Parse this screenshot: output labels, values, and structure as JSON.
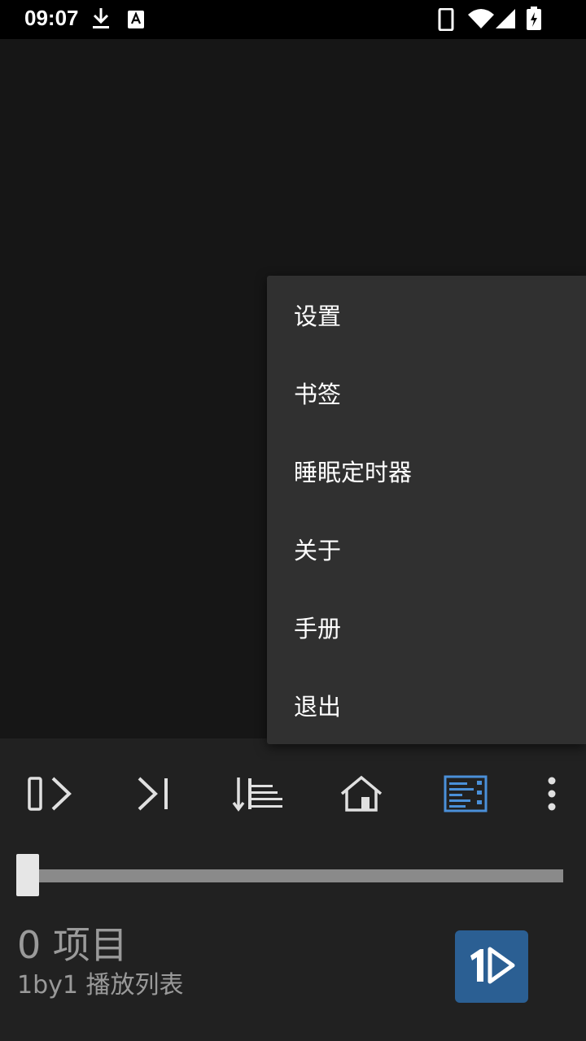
{
  "status_bar": {
    "time": "09:07",
    "icons": [
      "download-icon",
      "keyboard-a-icon",
      "phone-icon",
      "wifi-icon",
      "signal-icon",
      "battery-charging-icon"
    ]
  },
  "menu": {
    "items": [
      {
        "label": "设置"
      },
      {
        "label": "书签"
      },
      {
        "label": "睡眠定时器"
      },
      {
        "label": "关于"
      },
      {
        "label": "手册"
      },
      {
        "label": "退出"
      }
    ]
  },
  "toolbar": {
    "icons": [
      "play-next-icon",
      "skip-end-icon",
      "sort-icon",
      "home-icon",
      "playlist-view-icon",
      "more-vert-icon"
    ],
    "active_color": "#4a90d9",
    "icon_color": "#e0e0e0"
  },
  "seek": {
    "progress": 0
  },
  "playlist": {
    "item_count": "0 项目",
    "name": "1by1 播放列表"
  },
  "colors": {
    "background": "#161616",
    "menu_bg": "#303030",
    "bottom_bg": "#212121",
    "play_button": "#2b5f93"
  }
}
